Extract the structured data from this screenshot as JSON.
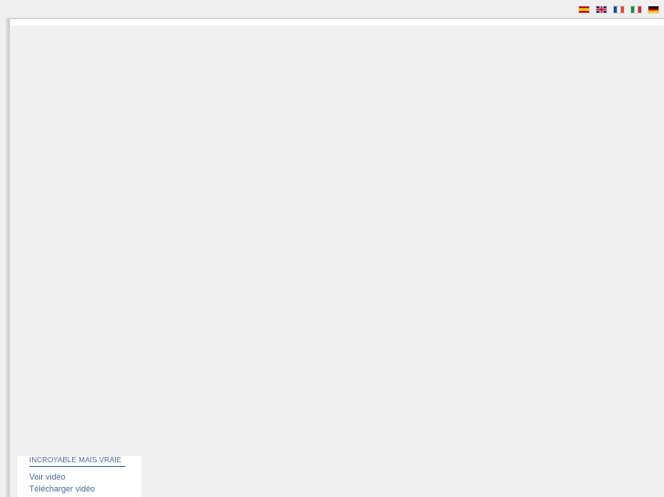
{
  "languages": [
    {
      "code": "es",
      "icon": "spain-flag-icon"
    },
    {
      "code": "en",
      "icon": "uk-flag-icon"
    },
    {
      "code": "fr",
      "icon": "france-flag-icon"
    },
    {
      "code": "it",
      "icon": "italy-flag-icon"
    },
    {
      "code": "de",
      "icon": "germany-flag-icon"
    }
  ],
  "video_panel": {
    "title": "INCROYABLE MAIS VRAIE",
    "watch_label": "Voir vidéo",
    "download_label": "Télécharger vidéo"
  },
  "colors": {
    "background": "#f0f0f0",
    "panel": "#ffffff",
    "link": "#4b6a9a"
  }
}
